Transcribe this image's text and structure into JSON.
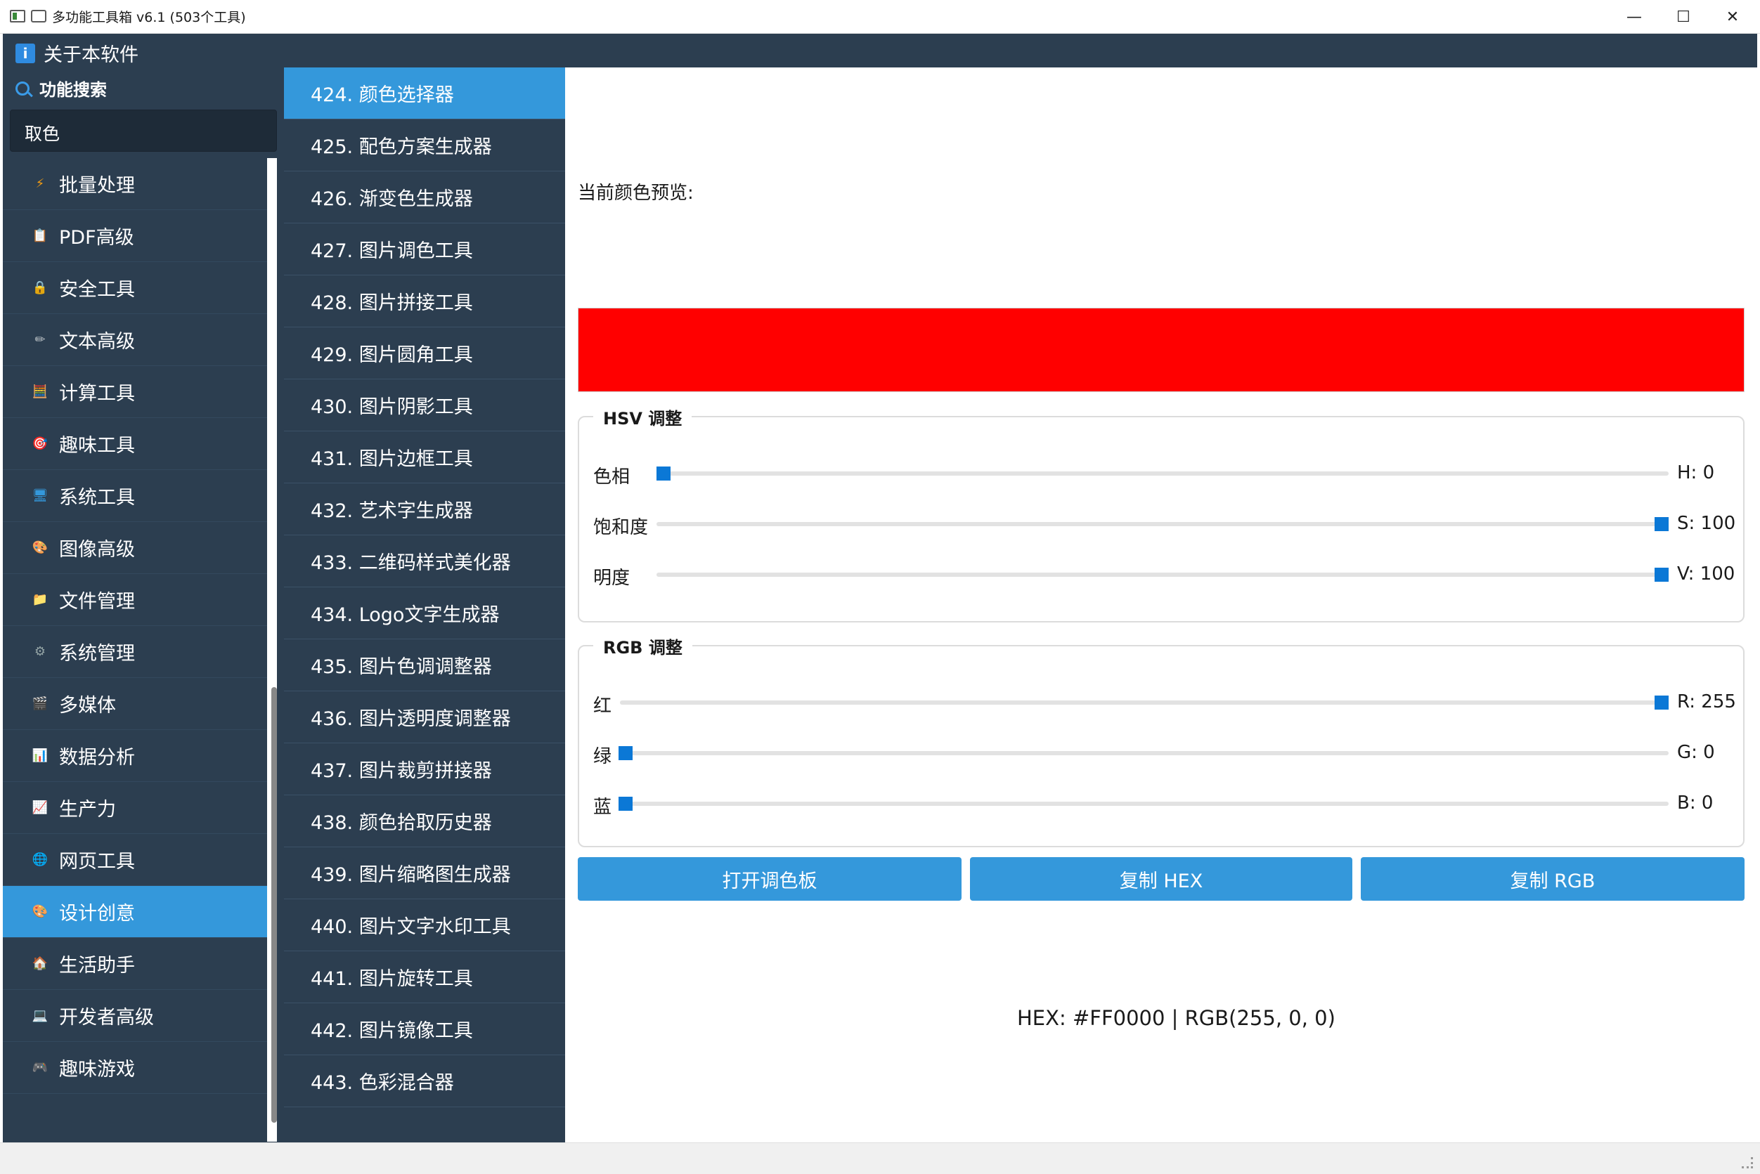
{
  "window": {
    "title": "多功能工具箱 v6.1 (503个工具)",
    "minimize": "—",
    "maximize": "☐",
    "close": "✕"
  },
  "header": {
    "about_label": "关于本软件",
    "about_icon": "i"
  },
  "sidebar": {
    "search_label": "功能搜索",
    "search_value": "取色",
    "categories": [
      {
        "label": "批量处理",
        "icon": "lightning-icon",
        "glyph": "⚡",
        "color": "#f39c12"
      },
      {
        "label": "PDF高级",
        "icon": "clipboard-icon",
        "glyph": "📋",
        "color": "#e0b060"
      },
      {
        "label": "安全工具",
        "icon": "lock-icon",
        "glyph": "🔒",
        "color": "#f1c40f"
      },
      {
        "label": "文本高级",
        "icon": "pencil-icon",
        "glyph": "✏",
        "color": "#bdc3c7"
      },
      {
        "label": "计算工具",
        "icon": "abacus-icon",
        "glyph": "🧮",
        "color": "#e74c3c"
      },
      {
        "label": "趣味工具",
        "icon": "target-icon",
        "glyph": "🎯",
        "color": "#e74c3c"
      },
      {
        "label": "系统工具",
        "icon": "monitor-icon",
        "glyph": "🖥",
        "color": "#3498db"
      },
      {
        "label": "图像高级",
        "icon": "palette-icon",
        "glyph": "🎨",
        "color": "#e67e22"
      },
      {
        "label": "文件管理",
        "icon": "folder-icon",
        "glyph": "📁",
        "color": "#f1c40f"
      },
      {
        "label": "系统管理",
        "icon": "gear-icon",
        "glyph": "⚙",
        "color": "#95a5a6"
      },
      {
        "label": "多媒体",
        "icon": "clapper-icon",
        "glyph": "🎬",
        "color": "#9b59b6"
      },
      {
        "label": "数据分析",
        "icon": "bar-chart-icon",
        "glyph": "📊",
        "color": "#e74c3c"
      },
      {
        "label": "生产力",
        "icon": "trend-chart-icon",
        "glyph": "📈",
        "color": "#e74c3c"
      },
      {
        "label": "网页工具",
        "icon": "globe-icon",
        "glyph": "🌐",
        "color": "#5dade2"
      },
      {
        "label": "设计创意",
        "icon": "palette-icon",
        "glyph": "🎨",
        "color": "#e67e22"
      },
      {
        "label": "生活助手",
        "icon": "house-icon",
        "glyph": "🏠",
        "color": "#e67e22"
      },
      {
        "label": "开发者高级",
        "icon": "laptop-icon",
        "glyph": "💻",
        "color": "#3498db"
      },
      {
        "label": "趣味游戏",
        "icon": "gamepad-icon",
        "glyph": "🎮",
        "color": "#9b59b6"
      }
    ],
    "active_index": 14
  },
  "tools": {
    "items": [
      "424. 颜色选择器",
      "425. 配色方案生成器",
      "426. 渐变色生成器",
      "427. 图片调色工具",
      "428. 图片拼接工具",
      "429. 图片圆角工具",
      "430. 图片阴影工具",
      "431. 图片边框工具",
      "432. 艺术字生成器",
      "433. 二维码样式美化器",
      "434. Logo文字生成器",
      "435. 图片色调调整器",
      "436. 图片透明度调整器",
      "437. 图片裁剪拼接器",
      "438. 颜色拾取历史器",
      "439. 图片缩略图生成器",
      "440. 图片文字水印工具",
      "441. 图片旋转工具",
      "442. 图片镜像工具",
      "443. 色彩混合器"
    ],
    "active_index": 0
  },
  "main": {
    "preview_label": "当前颜色预览:",
    "preview_color": "#FF0000",
    "hsv_group": {
      "title": "HSV 调整",
      "rows": [
        {
          "label": "色相",
          "value_text": "H: 0",
          "value": 0,
          "max": 360
        },
        {
          "label": "饱和度",
          "value_text": "S: 100",
          "value": 100,
          "max": 100
        },
        {
          "label": "明度",
          "value_text": "V: 100",
          "value": 100,
          "max": 100
        }
      ]
    },
    "rgb_group": {
      "title": "RGB 调整",
      "rows": [
        {
          "label": "红",
          "value_text": "R: 255",
          "value": 255,
          "max": 255
        },
        {
          "label": "绿",
          "value_text": "G: 0",
          "value": 0,
          "max": 255
        },
        {
          "label": "蓝",
          "value_text": "B: 0",
          "value": 0,
          "max": 255
        }
      ]
    },
    "buttons": {
      "open_palette": "打开调色板",
      "copy_hex": "复制 HEX",
      "copy_rgb": "复制 RGB"
    },
    "readout": "HEX: #FF0000  |  RGB(255, 0, 0)"
  },
  "colors": {
    "sidebar_bg": "#2c3e50",
    "accent": "#3498db",
    "slider_handle": "#0b78d6"
  }
}
